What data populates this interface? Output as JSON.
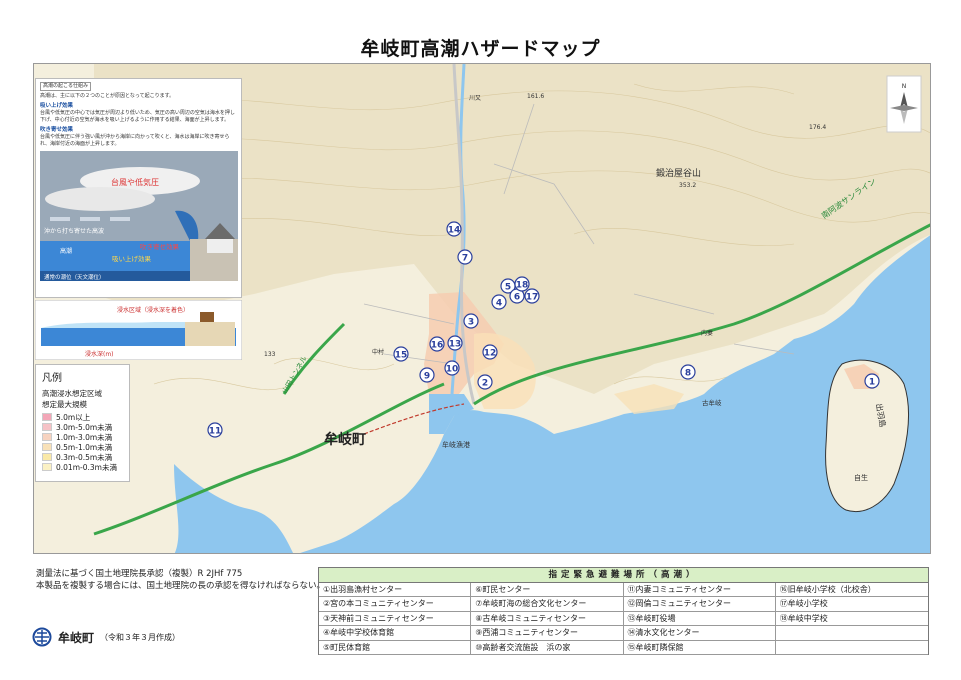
{
  "title": "牟岐町高潮ハザードマップ",
  "explain": {
    "heading": "高潮の起こる仕組み",
    "intro": "高潮は、主に以下の２つのことが原因となって起こります。",
    "suction_title": "吸い上げ効果",
    "suction_text": "台風や低気圧の中心では気圧が周辺より低いため、気圧の高い周辺の空気は海水を押し下げ、中心付近の空気が海水を吸い上げるように作用する結果、海面が上昇します。",
    "wind_title": "吹き寄せ効果",
    "wind_text": "台風や低気圧に伴う強い風が沖から海岸に向かって吹くと、海水は海岸に吹き寄せられ、海岸付近の海面が上昇します。",
    "diagram": {
      "storm_label": "台風や低気圧",
      "wave_label": "沖から打ち寄せた高波",
      "high_tide": "高潮",
      "wind_effect": "吹き寄せ効果",
      "suction_effect": "吸い上げ効果",
      "normal_tide": "通常の潮位（天文潮位）",
      "area_label": "浸水区域（浸水深を着色）",
      "depth_label": "浸水深(m)"
    }
  },
  "legend": {
    "title": "凡例",
    "subtitle1": "高潮浸水想定区域",
    "subtitle2": "想定最大規模",
    "items": [
      {
        "label": "5.0m以上",
        "color": "#f3a6b7"
      },
      {
        "label": "3.0m-5.0m未満",
        "color": "#f6c2c6"
      },
      {
        "label": "1.0m-3.0m未満",
        "color": "#f7d3c0"
      },
      {
        "label": "0.5m-1.0m未満",
        "color": "#f8e1b8"
      },
      {
        "label": "0.3m-0.5m未満",
        "color": "#fae9a8"
      },
      {
        "label": "0.01m-0.3m未満",
        "color": "#fbf1c4"
      }
    ]
  },
  "map_labels": {
    "town": "牟岐町",
    "mountain": "鍛治屋谷山",
    "mountain_elev": "353.2",
    "sunline": "南阿波サンライン",
    "fishing_port": "牟岐漁港",
    "island": "出羽島",
    "jisei": "自生",
    "furumugi": "古牟岐",
    "tunnel": "山田トンネル",
    "uchitsuma": "内妻",
    "kawamata": "川又",
    "nakamura": "中村",
    "elev_1": "161.6",
    "elev_2": "176.4",
    "elev_3": "133",
    "compass": "N"
  },
  "markers": [
    "1",
    "2",
    "3",
    "4",
    "5",
    "6",
    "7",
    "8",
    "9",
    "10",
    "11",
    "12",
    "13",
    "14",
    "15",
    "16",
    "17",
    "18"
  ],
  "copyright": {
    "line1": "測量法に基づく国土地理院長承認（複製）R 2JHf 775",
    "line2": "本製品を複製する場合には、国土地理院の長の承認を得なければならない。"
  },
  "footer": {
    "town": "牟岐町",
    "made": "（令和３年３月作成）"
  },
  "shelters": {
    "header": "指定緊急避難場所（高潮）",
    "items": [
      "①出羽島漁村センター",
      "⑥町民センター",
      "⑪内妻コミュニティセンター",
      "⑯旧牟岐小学校（北校舎）",
      "②宮の本コミュニティセンター",
      "⑦牟岐町海の総合文化センター",
      "⑫岡倫コミュニティセンター",
      "⑰牟岐小学校",
      "③天神前コミュニティセンター",
      "⑧古牟岐コミュニティセンター",
      "⑬牟岐町役場",
      "⑱牟岐中学校",
      "④牟岐中学校体育館",
      "⑨西浦コミュニティセンター",
      "⑭清水文化センター",
      "",
      "⑤町民体育館",
      "⑩高齢者交流施設　浜の家",
      "⑮牟岐町隣保館",
      ""
    ]
  },
  "colors": {
    "sea": "#8ec6ee",
    "land": "#f4efdd",
    "flood": "#f6cdb0",
    "road_green": "#3aa64a",
    "marker": "#2a3f9c"
  }
}
